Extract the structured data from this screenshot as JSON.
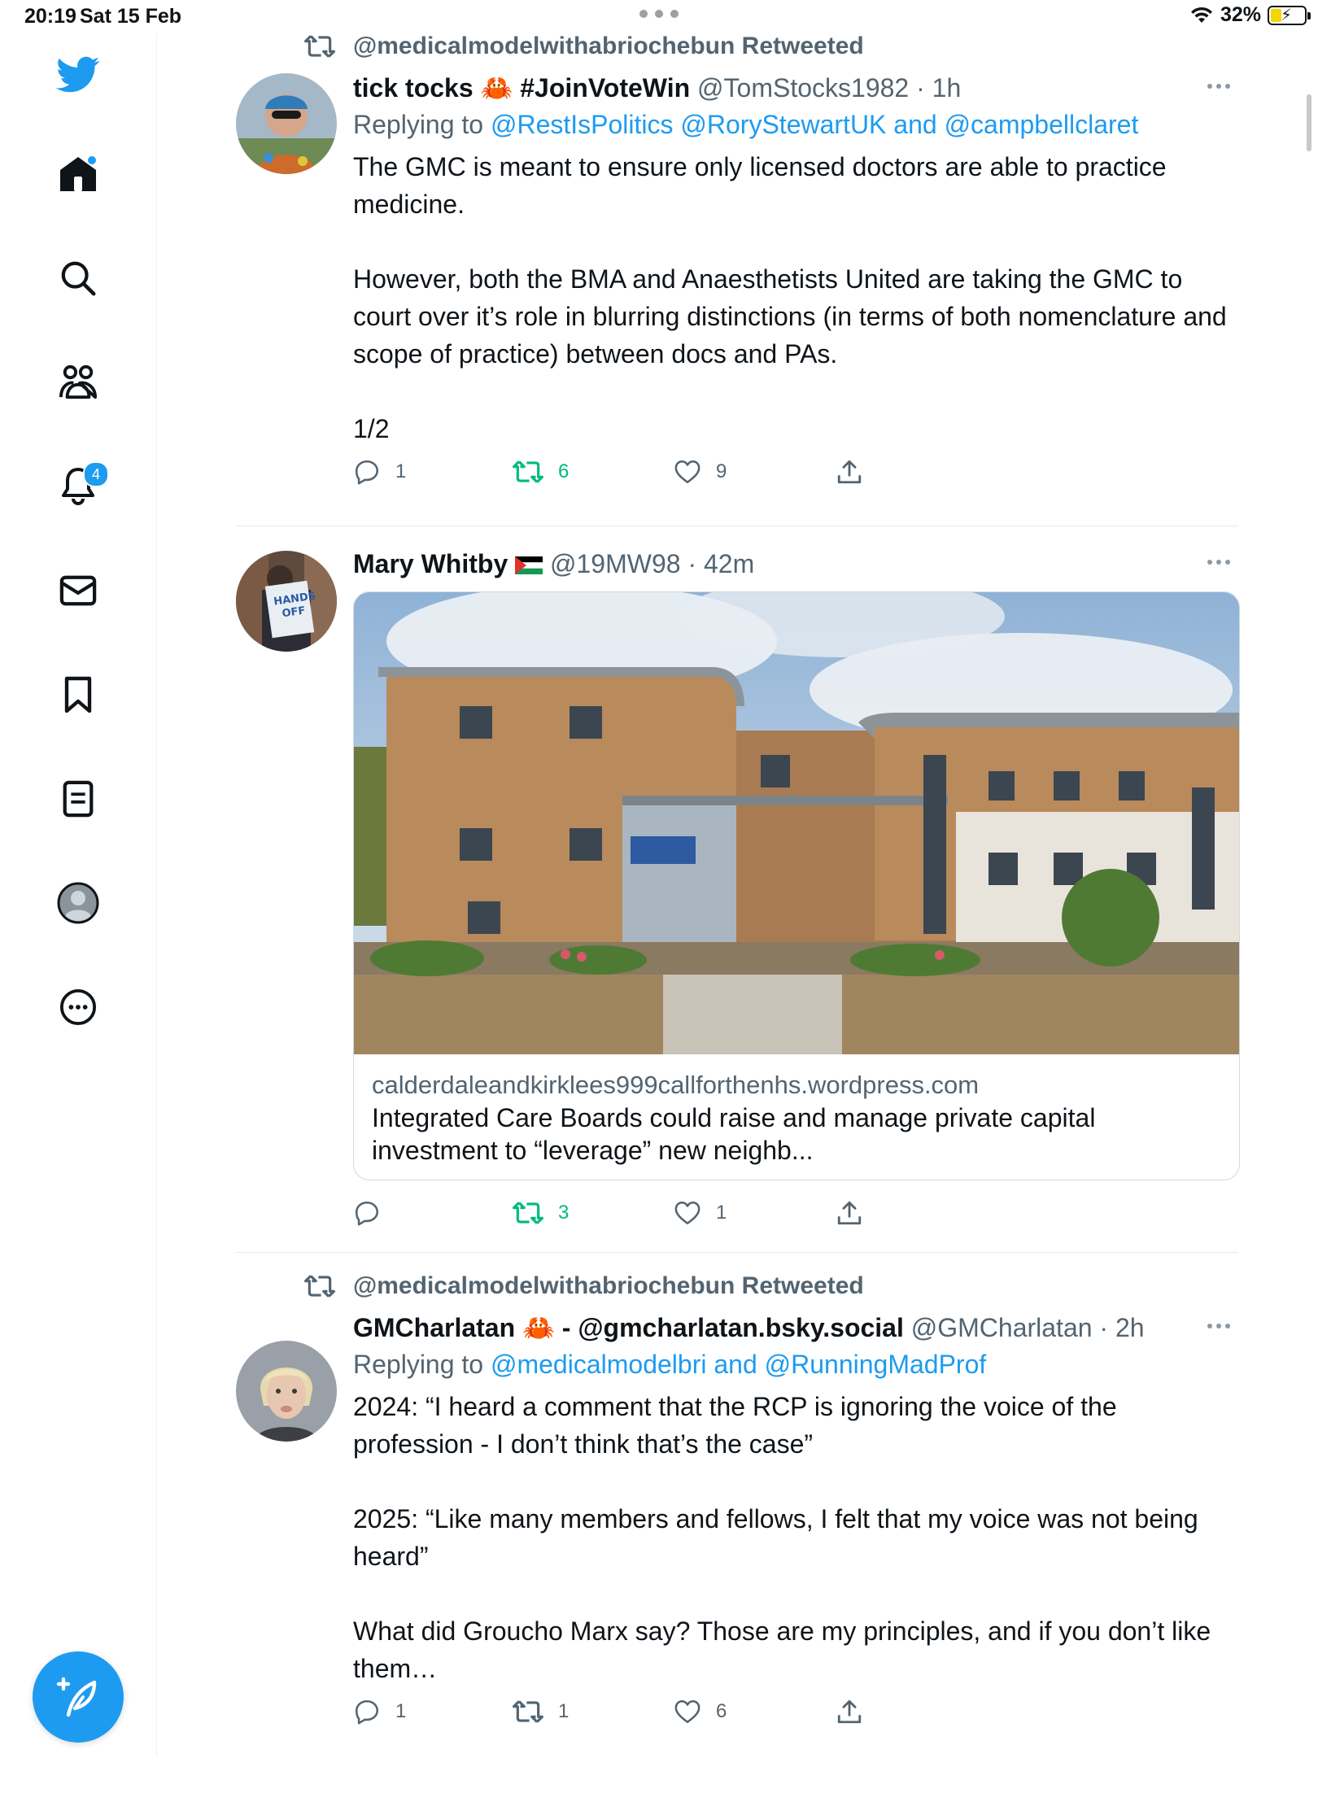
{
  "status_bar": {
    "time": "20:19",
    "date": "Sat 15 Feb",
    "battery": "32%"
  },
  "sidebar": {
    "notifications_badge": "4",
    "items": [
      "twitter-logo",
      "home",
      "search",
      "communities",
      "notifications",
      "messages",
      "bookmarks",
      "lists",
      "profile",
      "more"
    ]
  },
  "tweets": [
    {
      "retweeted_by": "@medicalmodelwithabriochebun Retweeted",
      "name": "tick tocks",
      "name_emoji": "🦀",
      "name_suffix": " #JoinVoteWin",
      "handle_time": "@TomStocks1982 · 1h",
      "replying_prefix": "Replying to ",
      "replying_links": "@RestIsPolitics @RoryStewartUK and @campbellclaret",
      "text": "The GMC is meant to ensure only licensed doctors are able to practice medicine.\n\nHowever, both the BMA and Anaesthetists United are taking the GMC to court over it’s role in blurring distinctions (in terms of both nomenclature and scope of practice) between docs and PAs.\n\n1/2",
      "replies": "1",
      "retweets": "6",
      "likes": "9"
    },
    {
      "name": "Mary Whitby",
      "handle_time": "@19MW98 · 42m",
      "card": {
        "domain": "calderdaleandkirklees999callforthenhs.wordpress.com",
        "title": "Integrated Care Boards could raise and manage private capital investment to “leverage” new neighb..."
      },
      "replies": "",
      "retweets": "3",
      "likes": "1"
    },
    {
      "retweeted_by": "@medicalmodelwithabriochebun Retweeted",
      "name": "GMCharlatan",
      "name_emoji": "🦀",
      "name_suffix": " - @gmcharlatan.bsky.social",
      "handle_time": "@GMCharlatan · 2h",
      "replying_prefix": "Replying to ",
      "replying_links": "@medicalmodelbri and @RunningMadProf",
      "text": "2024: “I heard a comment that the RCP is ignoring the voice of the profession - I don’t think that’s the case”\n\n2025: “Like many members and fellows, I felt that my voice was not being heard”\n\nWhat did Groucho Marx say? Those are my principles, and if you don’t like them…",
      "replies": "1",
      "retweets": "1",
      "likes": "6"
    }
  ],
  "colors": {
    "accent": "#1d9bf0",
    "retweet_green": "#00ba7c",
    "secondary_text": "#536471"
  }
}
